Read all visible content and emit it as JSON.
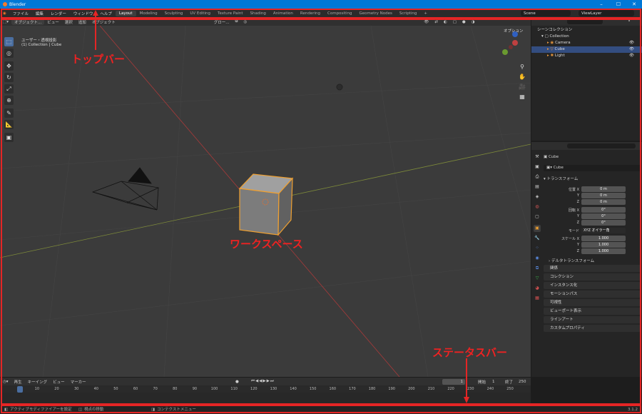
{
  "window": {
    "title": "Blender"
  },
  "topbar": {
    "menus": [
      "ファイル",
      "編集",
      "レンダー",
      "ウィンドウ",
      "ヘルプ"
    ],
    "workspaces": [
      "Layout",
      "Modeling",
      "Sculpting",
      "UV Editing",
      "Texture Paint",
      "Shading",
      "Animation",
      "Rendering",
      "Compositing",
      "Geometry Nodes",
      "Scripting"
    ],
    "add_tab": "+",
    "scene": "Scene",
    "view_layer": "ViewLayer"
  },
  "viewport_header": {
    "mode": "オブジェクト...",
    "menus": [
      "ビュー",
      "選択",
      "追加",
      "オブジェクト"
    ],
    "transform_orientation": "グロー...",
    "options": "オプション"
  },
  "viewport": {
    "view_name": "ユーザー・透視投影",
    "collection_info": "(1) Collection | Cube"
  },
  "outliner": {
    "root": "シーンコレクション",
    "collection": "Collection",
    "objects": [
      "Camera",
      "Cube",
      "Light"
    ],
    "selected": "Cube"
  },
  "properties": {
    "object_name": "Cube",
    "object_field": "Cube",
    "transform_title": "トランスフォーム",
    "location_label": "位置 X",
    "rotation_label": "回転 X",
    "scale_label": "スケール X",
    "axis_y": "Y",
    "axis_z": "Z",
    "location": [
      "0 m",
      "0 m",
      "0 m"
    ],
    "rotation": [
      "0°",
      "0°",
      "0°"
    ],
    "mode_label": "モード",
    "mode_value": "XYZ オイラー角",
    "scale": [
      "1.000",
      "1.000",
      "1.000"
    ],
    "delta_transform": "デルタトランスフォーム",
    "panels": [
      "関係",
      "コレクション",
      "インスタンス化",
      "モーションパス",
      "可視性",
      "ビューポート表示",
      "ラインアート",
      "カスタムプロパティ"
    ]
  },
  "timeline": {
    "menus": [
      "再生",
      "キーイング",
      "ビュー",
      "マーカー"
    ],
    "current_frame": "1",
    "start_label": "開始",
    "start": "1",
    "end_label": "終了",
    "end": "250",
    "ticks": [
      "1",
      "10",
      "20",
      "30",
      "40",
      "50",
      "60",
      "70",
      "80",
      "90",
      "100",
      "110",
      "120",
      "130",
      "140",
      "150",
      "160",
      "170",
      "180",
      "190",
      "200",
      "210",
      "220",
      "230",
      "240",
      "250"
    ]
  },
  "statusbar": {
    "items": [
      "アクティブモディファイアーを設定",
      "視点の移動",
      "コンテクストメニュー"
    ],
    "version": "3.1.2"
  },
  "annotations": {
    "top": "トップバー",
    "workspace": "ワークスペース",
    "status": "ステータスバー"
  },
  "colors": {
    "annotation": "#e52525",
    "select": "#334d80",
    "accent": "#4a6ea0",
    "object_outline": "#f0a030"
  }
}
